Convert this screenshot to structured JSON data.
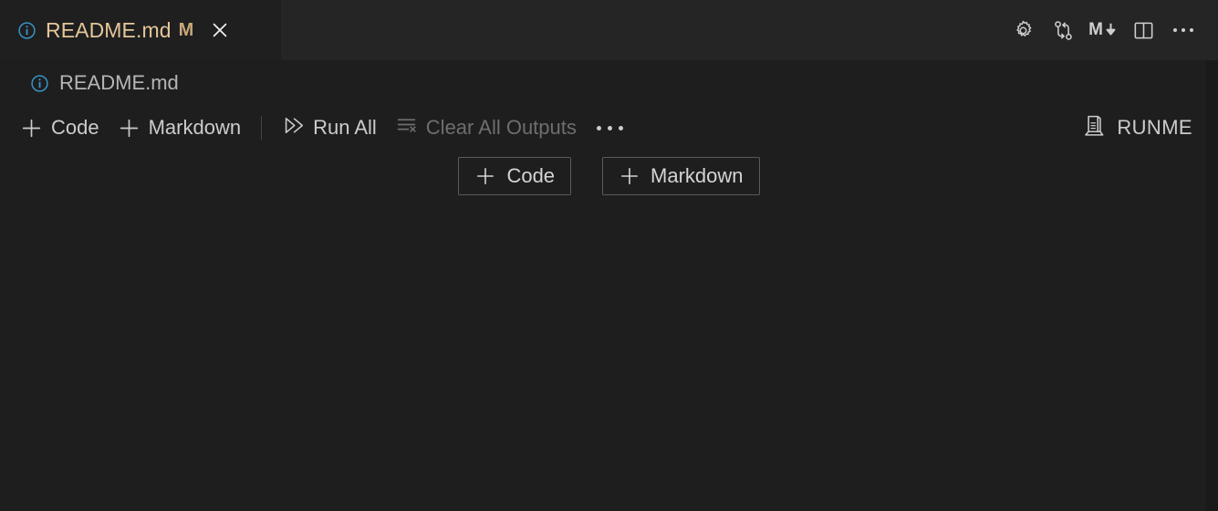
{
  "tab": {
    "icon": "info-circle-icon",
    "title": "README.md",
    "dirty_indicator": "M",
    "close_icon": "close-icon",
    "title_color": "#e4c699",
    "dirty_color": "#c8a878",
    "background": "#1f1f1f"
  },
  "tabbar_actions": [
    {
      "name": "settings-gear-icon",
      "label": "",
      "icon": "gear-icon"
    },
    {
      "name": "git-compare-icon",
      "label": "",
      "icon": "git-compare-icon"
    },
    {
      "name": "markdown-preview-icon",
      "label": "M",
      "icon": "markdown-down-icon"
    },
    {
      "name": "split-editor-icon",
      "label": "",
      "icon": "split-editor-icon"
    },
    {
      "name": "more-actions-icon",
      "label": "",
      "icon": "ellipsis-icon"
    }
  ],
  "breadcrumb": {
    "icon": "info-circle-icon",
    "label": "README.md",
    "color": "#b6b6b6"
  },
  "notebook_toolbar": {
    "add_code": {
      "label": "Code",
      "icon": "plus-icon"
    },
    "add_markdown": {
      "label": "Markdown",
      "icon": "plus-icon"
    },
    "run_all": {
      "label": "Run All",
      "icon": "run-all-icon"
    },
    "clear_all_outputs": {
      "label": "Clear All Outputs",
      "icon": "clear-outputs-icon",
      "disabled": true,
      "disabled_color": "#6e6e6e"
    },
    "more": {
      "label": "",
      "icon": "ellipsis-icon"
    },
    "kernel": {
      "label": "RUNME",
      "icon": "server-kernel-icon"
    }
  },
  "cell_adders": [
    {
      "label": "Code",
      "icon": "plus-icon"
    },
    {
      "label": "Markdown",
      "icon": "plus-icon"
    }
  ],
  "theme": {
    "editor_background": "#1e1e1e",
    "tabbar_background": "#252526",
    "foreground": "#cccccc",
    "accent_blue": "#3794c7",
    "border": "#5a5a5a",
    "scrollbar": "#1a1a1a"
  }
}
